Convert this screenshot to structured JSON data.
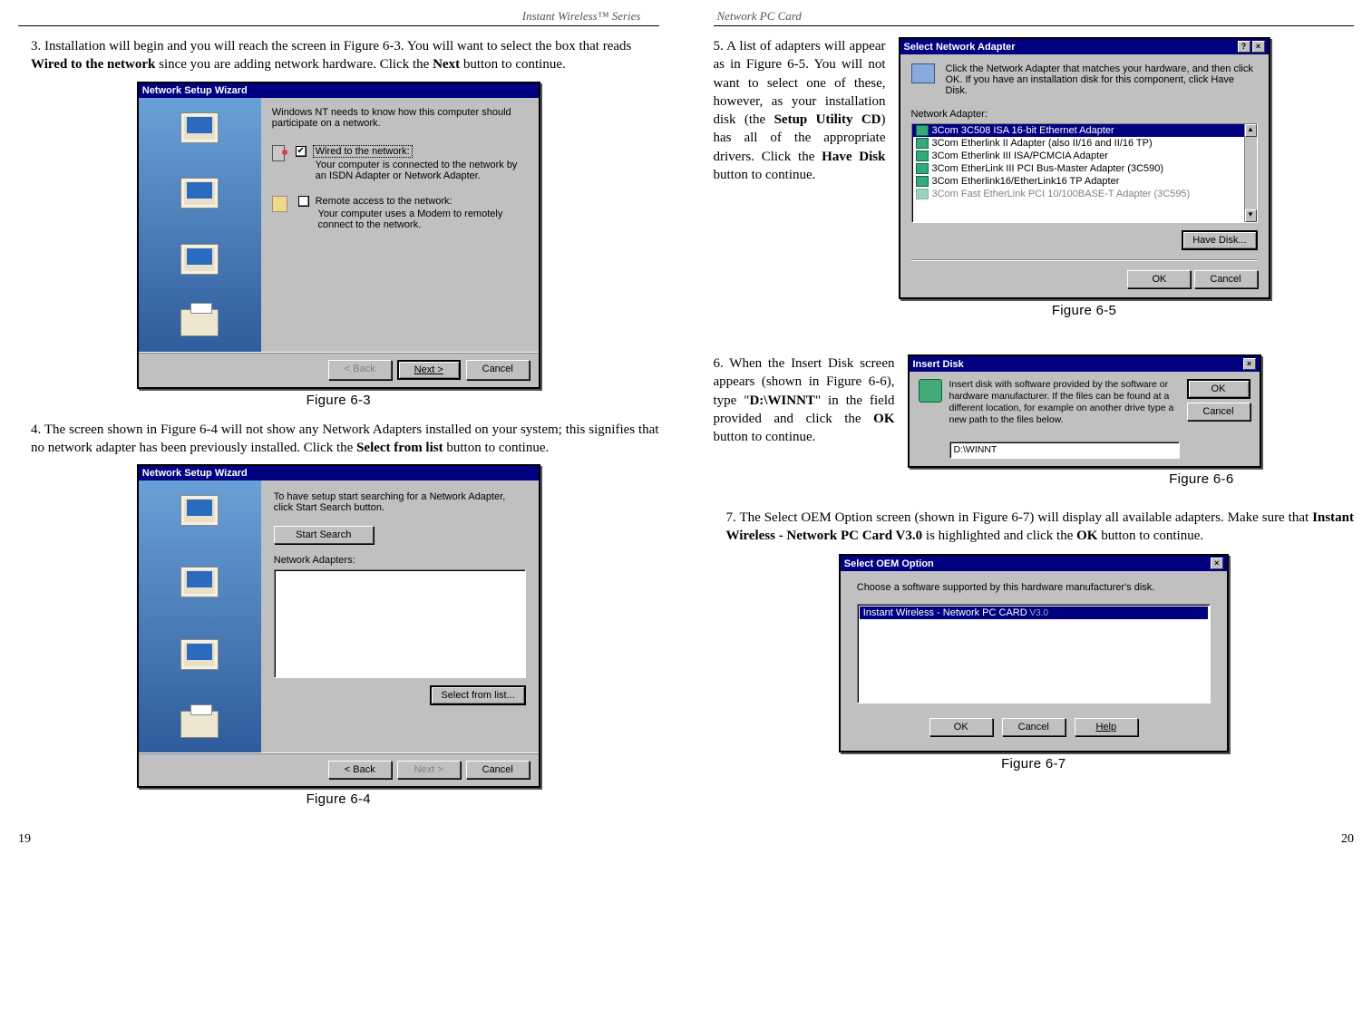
{
  "left_header": "Instant Wireless™ Series",
  "right_header": "Network PC Card",
  "page_left_num": "19",
  "page_right_num": "20",
  "step3": {
    "num": "3.",
    "text_a": "Installation will begin and you will reach the screen in Figure 6-3. You will want to select the box that reads ",
    "bold1": "Wired to the network",
    "text_b": " since you are adding network hardware. Click the ",
    "bold2": "Next",
    "text_c": " button to continue."
  },
  "fig63": {
    "title": "Network Setup Wizard",
    "intro": "Windows NT needs to know how this computer should participate on a network.",
    "opt1_label": "Wired to the network:",
    "opt1_desc": "Your computer is connected to the network by an ISDN Adapter or Network Adapter.",
    "opt2_label": "Remote access to the network:",
    "opt2_desc": "Your computer uses a Modem to remotely connect to the network.",
    "back": "< Back",
    "next": "Next >",
    "cancel": "Cancel",
    "caption": "Figure 6-3"
  },
  "step4": {
    "num": "4.",
    "text_a": "The screen shown in Figure 6-4 will not show any Network Adapters installed on your system; this signifies that no network adapter has been previously installed. Click the ",
    "bold1": "Select from list",
    "text_b": " button to continue."
  },
  "fig64": {
    "title": "Network Setup Wizard",
    "intro": "To have setup start searching for a Network Adapter, click Start Search button.",
    "start_search": "Start Search",
    "na_label": "Network Adapters:",
    "select_from_list": "Select from list...",
    "back": "< Back",
    "next": "Next >",
    "cancel": "Cancel",
    "caption": "Figure 6-4"
  },
  "step5": {
    "num": "5.",
    "text_a": "A list of adapters will appear as in Figure 6-5. You will not want to select one of these, however, as your installation disk (the ",
    "bold1": "Setup Utility CD",
    "text_b": ") has all of the appropriate drivers. Click the ",
    "bold2": "Have Disk",
    "text_c": " button to continue."
  },
  "fig65": {
    "title": "Select Network Adapter",
    "instr": "Click the Network Adapter that matches your hardware, and then click OK. If you have an installation disk for this component, click Have Disk.",
    "na_label": "Network Adapter:",
    "items": [
      "3Com 3C508 ISA 16-bit Ethernet Adapter",
      "3Com Etherlink II Adapter (also II/16 and II/16 TP)",
      "3Com Etherlink III ISA/PCMCIA Adapter",
      "3Com EtherLink III PCI Bus-Master Adapter (3C590)",
      "3Com Etherlink16/EtherLink16 TP Adapter",
      "3Com Fast EtherLink PCI 10/100BASE-T Adapter (3C595)"
    ],
    "have_disk": "Have Disk...",
    "ok": "OK",
    "cancel": "Cancel",
    "caption": "Figure 6-5"
  },
  "step6": {
    "num": "6.",
    "text_a": " When the Insert Disk screen appears (shown in Figure 6-6), type \"",
    "bold1": "D:\\WINNT",
    "text_b": "\" in the field provided and click the ",
    "bold2": "OK",
    "text_c": " button to continue."
  },
  "fig66": {
    "title": "Insert Disk",
    "msg": "Insert disk with software provided by the software or hardware manufacturer. If the files can be found at a different location, for example on another drive type a new path to the files below.",
    "ok": "OK",
    "cancel": "Cancel",
    "path": "D:\\WINNT",
    "caption": "Figure 6-6"
  },
  "step7": {
    "num": "7.",
    "text_a": "The Select OEM Option screen (shown in Figure 6-7) will display all available adapters.  Make sure that ",
    "bold1": "Instant Wireless  - Network PC Card V3.0",
    "text_b": "  is highlighted and click the ",
    "bold2": "OK",
    "text_c": " button to continue."
  },
  "fig67": {
    "title": "Select OEM Option",
    "instr": "Choose a software supported by this hardware manufacturer's disk.",
    "item": "Instant Wireless - Network PC CARD",
    "ver": " V3.0",
    "ok": "OK",
    "cancel": "Cancel",
    "help": "Help",
    "caption": "Figure 6-7"
  }
}
